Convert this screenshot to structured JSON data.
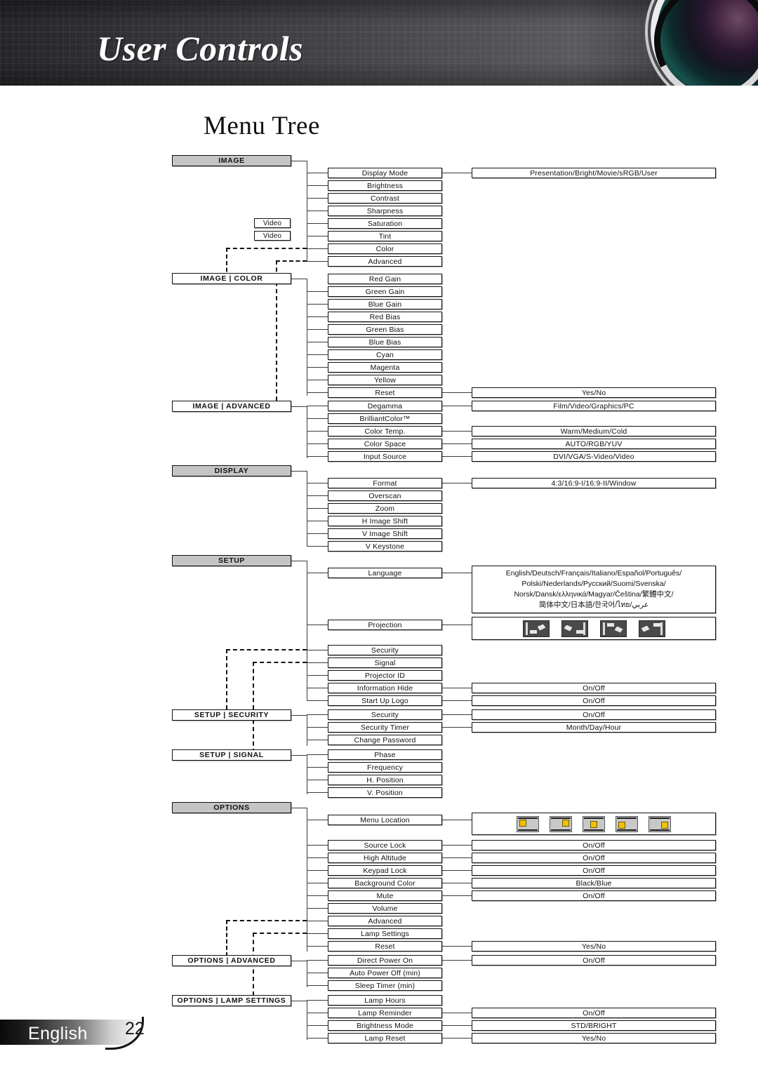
{
  "header": {
    "title": "User Controls"
  },
  "page_title": "Menu Tree",
  "footer": {
    "language": "English",
    "page_number": "22"
  },
  "tree": {
    "headers": {
      "image": "IMAGE",
      "image_color": "IMAGE | COLOR",
      "image_advanced": "IMAGE | ADVANCED",
      "display": "DISPLAY",
      "setup": "SETUP",
      "setup_security": "SETUP | SECURITY",
      "setup_signal": "SETUP | SIGNAL",
      "options": "OPTIONS",
      "options_advanced": "OPTIONS | ADVANCED",
      "options_lamp": "OPTIONS | LAMP SETTINGS"
    },
    "video_tag_1": "Video",
    "video_tag_2": "Video",
    "image_items": [
      "Display Mode",
      "Brightness",
      "Contrast",
      "Sharpness",
      "Saturation",
      "Tint",
      "Color",
      "Advanced"
    ],
    "image_values": {
      "display_mode": "Presentation/Bright/Movie/sRGB/User"
    },
    "image_color_items": [
      "Red Gain",
      "Green Gain",
      "Blue Gain",
      "Red Bias",
      "Green Bias",
      "Blue Bias",
      "Cyan",
      "Magenta",
      "Yellow",
      "Reset"
    ],
    "image_color_values": {
      "reset": "Yes/No"
    },
    "image_advanced_items": [
      "Degamma",
      "BrilliantColor™",
      "Color Temp.",
      "Color Space",
      "Input Source"
    ],
    "image_advanced_values": {
      "degamma": "Film/Video/Graphics/PC",
      "color_temp": "Warm/Medium/Cold",
      "color_space": "AUTO/RGB/YUV",
      "input_source": "DVI/VGA/S-Video/Video"
    },
    "display_items": [
      "Format",
      "Overscan",
      "Zoom",
      "H Image Shift",
      "V Image Shift",
      "V Keystone"
    ],
    "display_values": {
      "format": "4:3/16:9-I/16:9-II/Window"
    },
    "setup_items": [
      "Language",
      "Projection",
      "Security",
      "Signal",
      "Projector ID",
      "Information Hide",
      "Start Up Logo"
    ],
    "setup_values": {
      "language_lines": [
        "English/Deutsch/Français/Italiano/Español/Português/",
        "Polski/Nederlands/Русский/Suomi/Svenska/",
        "Norsk/Dansk/ελληνικά/Magyar/Čeština/繁體中文/",
        "简体中文/日本語/한국어/ไทย/عربي"
      ],
      "information_hide": "On/Off",
      "start_up_logo": "On/Off"
    },
    "setup_security_items": [
      "Security",
      "Security Timer",
      "Change Password"
    ],
    "setup_security_values": {
      "security": "On/Off",
      "security_timer": "Month/Day/Hour"
    },
    "setup_signal_items": [
      "Phase",
      "Frequency",
      "H. Position",
      "V. Position"
    ],
    "options_items": [
      "Menu Location",
      "Source Lock",
      "High Altitude",
      "Keypad Lock",
      "Background Color",
      "Mute",
      "Volume",
      "Advanced",
      "Lamp Settings",
      "Reset"
    ],
    "options_values": {
      "source_lock": "On/Off",
      "high_altitude": "On/Off",
      "keypad_lock": "On/Off",
      "background_color": "Black/Blue",
      "mute": "On/Off",
      "reset": "Yes/No"
    },
    "options_advanced_items": [
      "Direct Power On",
      "Auto Power Off (min)",
      "Sleep Timer (min)"
    ],
    "options_advanced_values": {
      "direct_power_on": "On/Off"
    },
    "options_lamp_items": [
      "Lamp Hours",
      "Lamp Reminder",
      "Brightness Mode",
      "Lamp Reset"
    ],
    "options_lamp_values": {
      "lamp_reminder": "On/Off",
      "brightness_mode": "STD/BRIGHT",
      "lamp_reset": "Yes/No"
    },
    "icons": {
      "projection_modes": [
        "front-table",
        "rear-table",
        "front-ceiling",
        "rear-ceiling"
      ],
      "menu_locations": [
        "top-left",
        "top-right",
        "center",
        "bottom-left",
        "bottom-right"
      ]
    }
  }
}
